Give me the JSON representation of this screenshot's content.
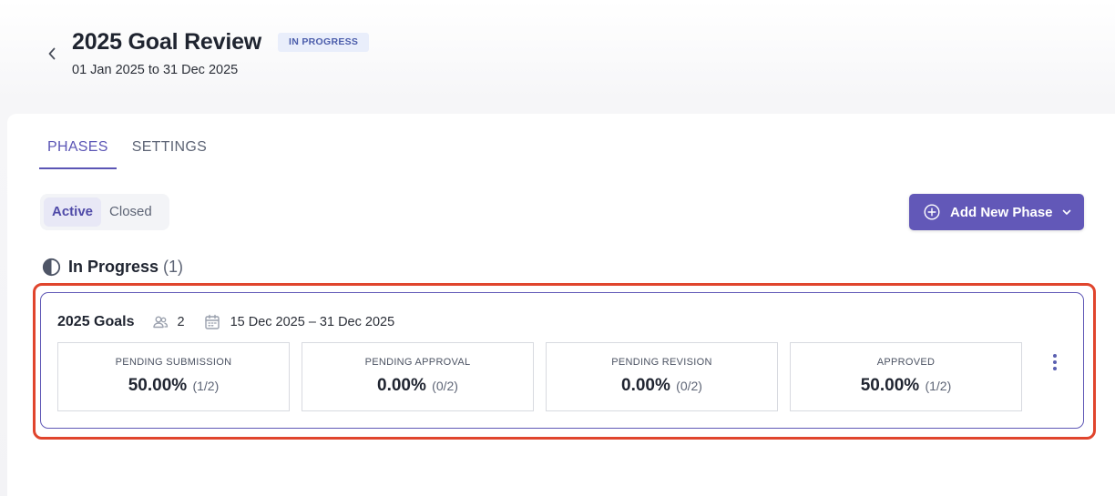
{
  "header": {
    "title": "2025 Goal Review",
    "status": "IN PROGRESS",
    "date_range": "01 Jan 2025 to 31 Dec 2025"
  },
  "tabs": [
    {
      "label": "PHASES",
      "active": true
    },
    {
      "label": "SETTINGS",
      "active": false
    }
  ],
  "filter": {
    "options": [
      "Active",
      "Closed"
    ],
    "selected": "Active"
  },
  "add_phase_button": {
    "label": "Add New Phase"
  },
  "section": {
    "title": "In Progress",
    "count": "(1)"
  },
  "phase": {
    "name": "2025 Goals",
    "participants": "2",
    "dates": "15 Dec 2025 – 31 Dec 2025",
    "stats": [
      {
        "label": "PENDING SUBMISSION",
        "value": "50.00%",
        "fraction": "(1/2)"
      },
      {
        "label": "PENDING APPROVAL",
        "value": "0.00%",
        "fraction": "(0/2)"
      },
      {
        "label": "PENDING REVISION",
        "value": "0.00%",
        "fraction": "(0/2)"
      },
      {
        "label": "APPROVED",
        "value": "50.00%",
        "fraction": "(1/2)"
      }
    ]
  },
  "colors": {
    "accent": "#6258b8",
    "highlight": "#e0452d",
    "badge_bg": "#e9eefb",
    "badge_text": "#4b5dab"
  },
  "icons": [
    "chevron-left-icon",
    "plus-circle-icon",
    "chevron-down-icon",
    "pie-progress-icon",
    "users-icon",
    "calendar-icon",
    "kebab-menu-icon"
  ]
}
